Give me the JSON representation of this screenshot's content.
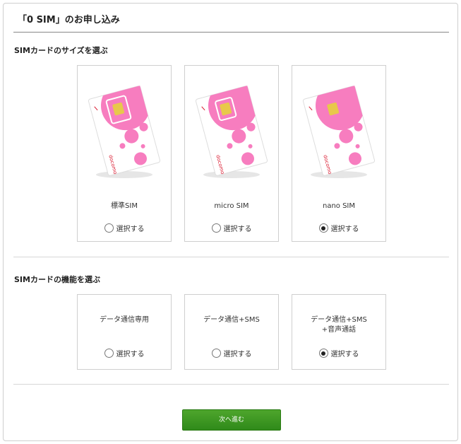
{
  "page": {
    "title": "「0 SIM」のお申し込み"
  },
  "size_section": {
    "heading": "SIMカードのサイズを選ぶ",
    "options": [
      {
        "label": "標準SIM",
        "radio_label": "選択する",
        "selected": false
      },
      {
        "label": "micro SIM",
        "radio_label": "選択する",
        "selected": false
      },
      {
        "label": "nano SIM",
        "radio_label": "選択する",
        "selected": true
      }
    ],
    "card_brand": "docomo"
  },
  "function_section": {
    "heading": "SIMカードの機能を選ぶ",
    "options": [
      {
        "label_line1": "データ通信専用",
        "label_line2": "",
        "radio_label": "選択する",
        "selected": false
      },
      {
        "label_line1": "データ通信+SMS",
        "label_line2": "",
        "radio_label": "選択する",
        "selected": false
      },
      {
        "label_line1": "データ通信+SMS",
        "label_line2": "+音声通話",
        "radio_label": "選択する",
        "selected": true
      }
    ]
  },
  "actions": {
    "next_label": "次へ進む"
  },
  "colors": {
    "sim_pink": "#f77dbf",
    "chip_gold": "#e8c84a",
    "button_green": "#3a961f",
    "brand_red": "#d9152b"
  }
}
